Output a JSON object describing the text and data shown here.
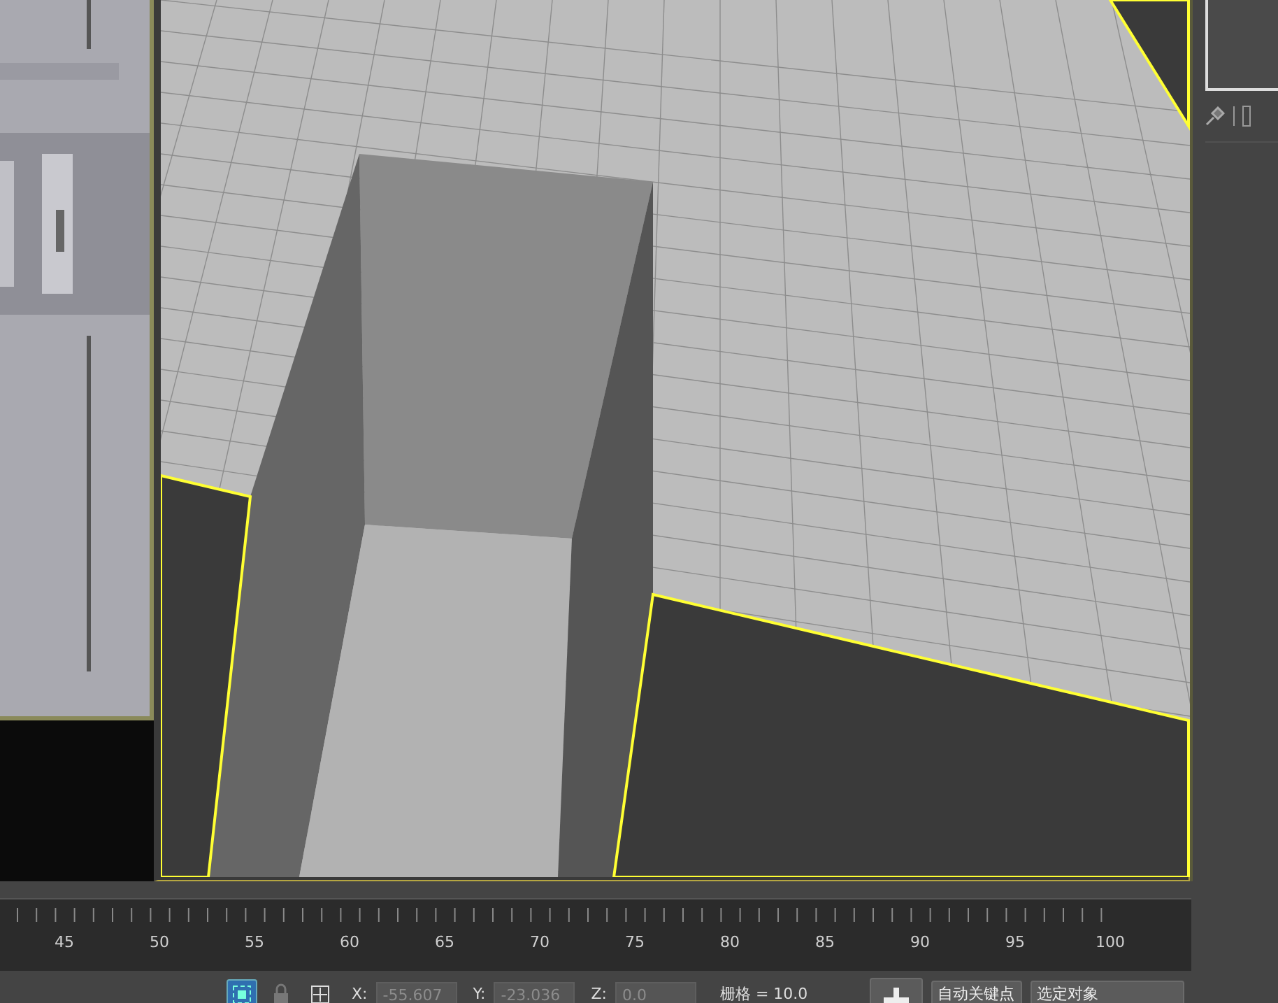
{
  "timeline": {
    "ticks": [
      "45",
      "50",
      "55",
      "60",
      "65",
      "70",
      "75",
      "80",
      "85",
      "90",
      "95",
      "100"
    ]
  },
  "status_bar": {
    "tools": [
      {
        "kind": "select",
        "selected": true
      },
      {
        "kind": "lock",
        "selected": false
      },
      {
        "kind": "transform",
        "selected": false
      }
    ],
    "coords": [
      {
        "label": "X:",
        "value": "-55.607"
      },
      {
        "label": "Y:",
        "value": "-23.036"
      },
      {
        "label": "Z:",
        "value": "0.0"
      }
    ],
    "grid": "栅格 = 10.0",
    "auto_key": "自动关键点",
    "selection_set": "选定对象"
  }
}
